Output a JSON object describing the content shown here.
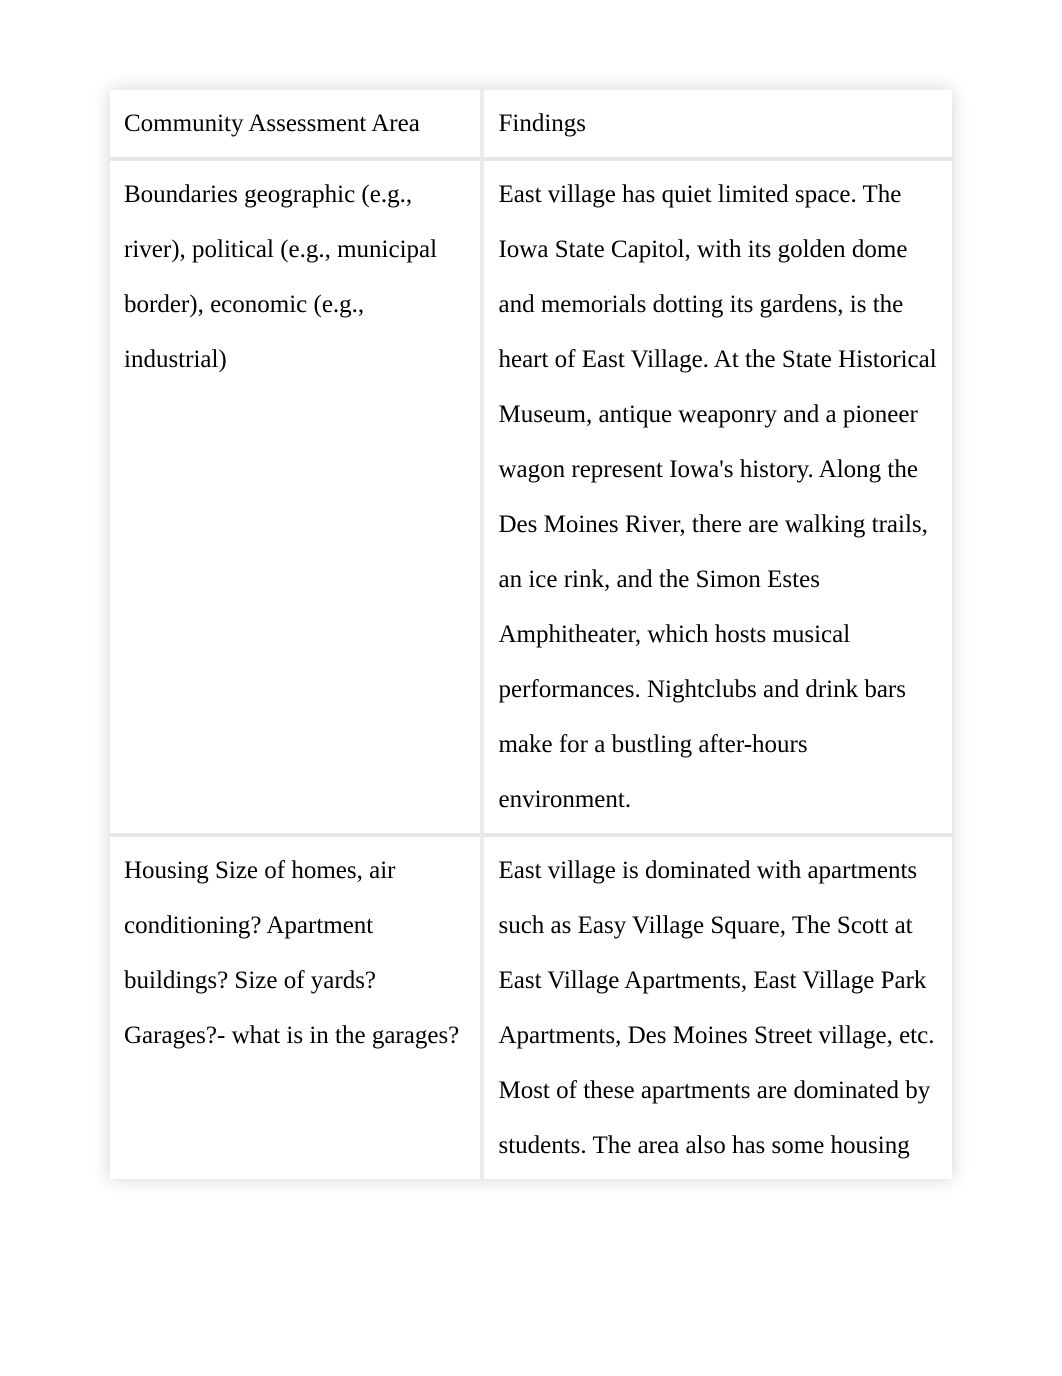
{
  "table": {
    "headers": {
      "col0": "Community Assessment Area",
      "col1": "Findings"
    },
    "rows": [
      {
        "area": "Boundaries\ngeographic (e.g., river), political (e.g., municipal border), economic (e.g., industrial)",
        "findings": "East village has quiet limited space. The Iowa State Capitol, with its golden dome and memorials dotting its gardens, is the heart of East Village. At the State Historical Museum, antique weaponry and a pioneer wagon represent Iowa's history. Along the Des Moines River, there are walking trails, an ice rink, and the Simon Estes Amphitheater, which hosts musical performances. Nightclubs and drink bars make for a bustling after-hours environment."
      },
      {
        "area": "Housing\nSize of homes, air conditioning? Apartment buildings? Size of yards? Garages?- what is in the garages?",
        "findings": " East village is dominated with apartments such as Easy Village Square, The Scott at East Village Apartments, East Village Park Apartments, Des Moines Street village, etc.  Most of these apartments are dominated by students. The area also has some housing"
      }
    ]
  }
}
